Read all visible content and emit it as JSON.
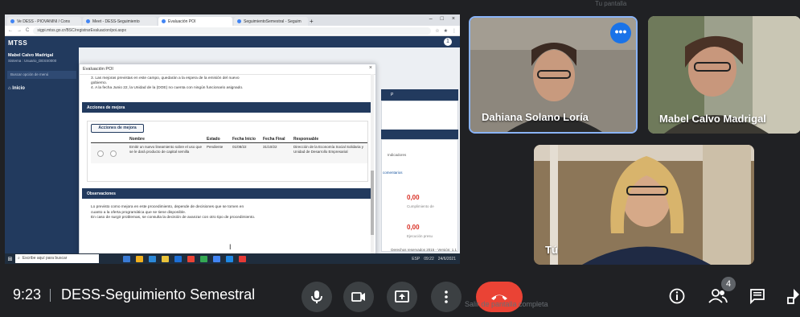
{
  "corner_caption": "Tu pantalla",
  "browser": {
    "tabs": [
      "Ve DESS - PIOVANINI / Cons",
      "Meet - DESS-Seguimiento",
      "Evaluación POI",
      "SeguimientoSemestral - Seguim"
    ],
    "new_tab": "+",
    "win_controls": [
      "–",
      "□",
      "×"
    ],
    "url": "sigpi.mtss.go.cr/BSC/registrarEvaluacion/poi.aspx"
  },
  "app": {
    "logo": "MTSS",
    "user_name": "Mabel Calvo Madrigal",
    "user_role": "Sistema : Usuario_DESS0000",
    "search_placeholder": "Buscar opción de menú",
    "inicio": "Inicio",
    "avatar": "1",
    "bg_values": [
      "0,00",
      "0,00"
    ],
    "bg_labels": [
      "Cumplimiento de",
      "Ejecución presu"
    ],
    "bg_snippets": [
      "Indicadores",
      "comentarios",
      "P"
    ],
    "footer": "Derechos reservados 2015 - Versión: 1.1"
  },
  "modal": {
    "title": "Evaluación POI",
    "close": "×",
    "notes": [
      "3. Las mejoras previstas en este campo, quedarán a la espera de la emisión del nuevo",
      "gobierno.",
      "4. A la fecha Junio 22, la Unidad de la (DOE) no cuenta con ningún funcionario asignado."
    ],
    "section_acciones": "Acciones de mejora",
    "button_acciones": "Acciones de mejora",
    "table_headers": [
      "Nombre",
      "Estado",
      "Fecha Inicio",
      "Fecha Final",
      "Responsable"
    ],
    "row": {
      "nombre": "Emitir un nuevo lineamiento sobre el uso que se le dará producto de capital semilla",
      "estado": "Pendiente",
      "fecha_inicio": "01/08/22",
      "fecha_final": "31/10/22",
      "responsable": "Dirección de la Economía Social Solidaria y Unidad de Desarrollo Empresarial"
    },
    "section_obs": "Observaciones",
    "observaciones": [
      "Lo previsto como mejora en este procedimiento, depende de decisiones que se tomen en",
      "cuanto a la oferta programática que se tiene disponible.",
      "En caso de surgir problemas, se consulta la decisión de avanzar con otro tipo de procedimiento."
    ],
    "cursor": "I"
  },
  "taskbar": {
    "start": "⊞",
    "search_placeholder": "Escribe aquí para buscar",
    "tray": [
      "ESP",
      "09:22",
      "24/6/2021"
    ],
    "app_colors": [
      "#3a7bd5",
      "#f2b01e",
      "#2b88d8",
      "#e8c23a",
      "#1d6fd6",
      "#ea4335",
      "#34a853",
      "#4285f4",
      "#1e88e5",
      "#e53935"
    ]
  },
  "participants": [
    {
      "name": "Dahiana Solano Loría",
      "speaking": true
    },
    {
      "name": "Mabel Calvo Madrigal",
      "speaking": false
    },
    {
      "name": "Tú",
      "speaking": false
    }
  ],
  "more_options": "•••",
  "meet_bar": {
    "time": "9:23",
    "meeting_title": "DESS-Seguimiento Semestral",
    "hangup_overlay": "Salir de pantalla completa",
    "people_count": "4",
    "colors": {
      "hangup": "#ea4335",
      "control_bg": "#3c4043",
      "accent": "#1a73e8"
    }
  }
}
